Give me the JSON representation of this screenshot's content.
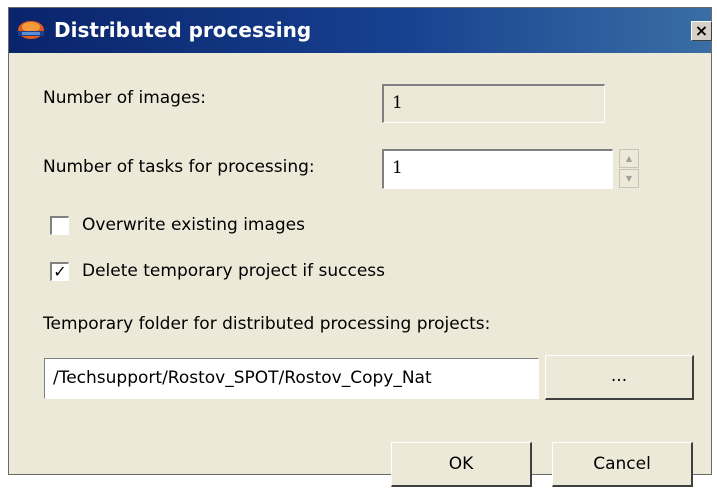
{
  "window": {
    "title": "Distributed processing",
    "close_glyph": "×",
    "title_color": "#0a246a",
    "app_icon": "app-logo-icon"
  },
  "form": {
    "images_label": "Number of images:",
    "images_value": "1",
    "tasks_label": "Number of tasks for processing:",
    "tasks_value": "1",
    "overwrite_label": "Overwrite existing images",
    "overwrite_checked": false,
    "delete_label": "Delete temporary project if success",
    "delete_checked": true,
    "folder_label": "Temporary folder for distributed processing projects:",
    "folder_value": "/Techsupport/Rostov_SPOT/Rostov_Copy_Nat",
    "browse_label": "..."
  },
  "buttons": {
    "ok_label": "OK",
    "cancel_label": "Cancel"
  }
}
